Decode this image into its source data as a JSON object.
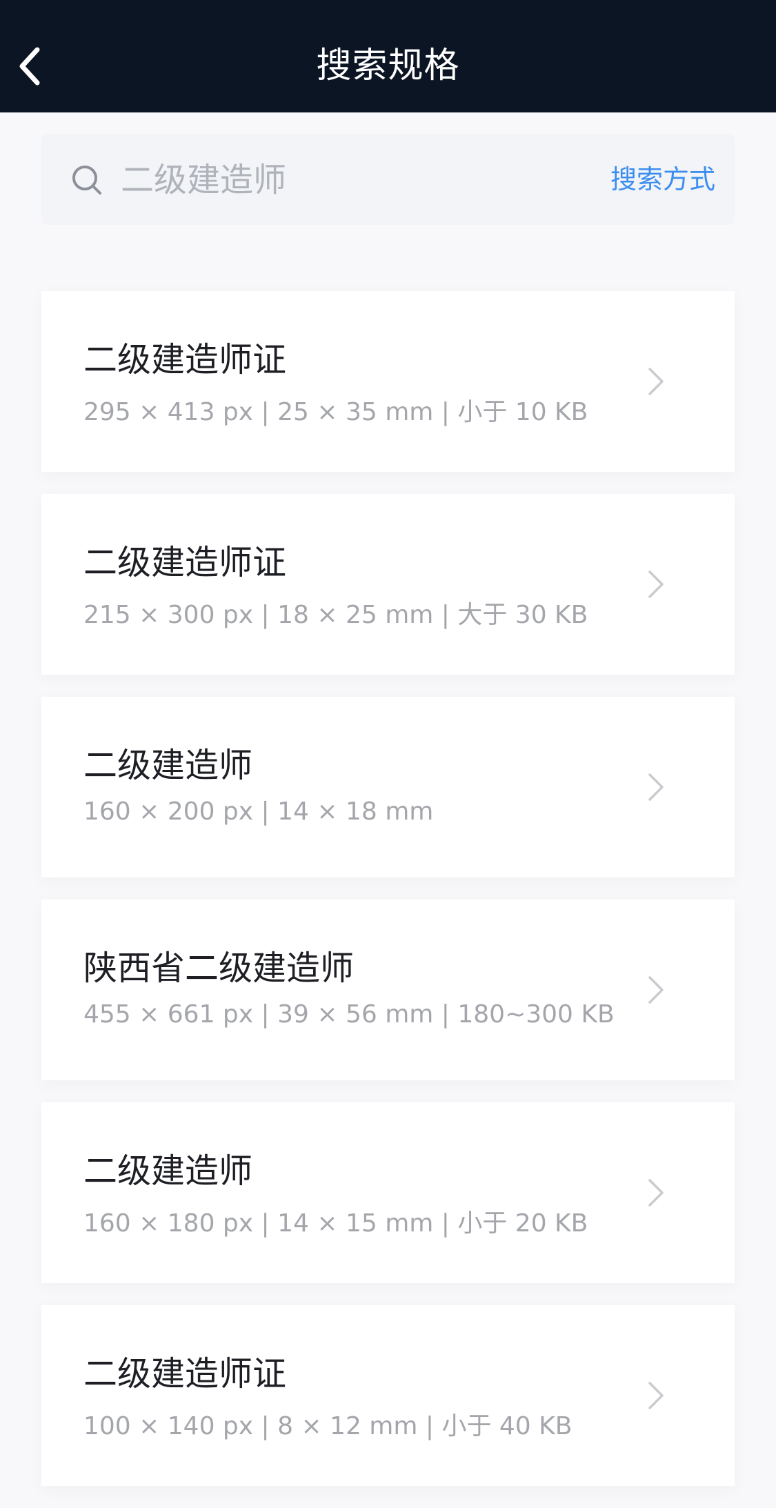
{
  "header": {
    "title": "搜索规格"
  },
  "search": {
    "value": "二级建造师",
    "placeholder": "二级建造师",
    "mode_label": "搜索方式"
  },
  "results": [
    {
      "title": "二级建造师证",
      "spec": "295 × 413 px | 25 × 35 mm | 小于 10 KB"
    },
    {
      "title": "二级建造师证",
      "spec": "215 × 300 px | 18 × 25 mm | 大于 30 KB"
    },
    {
      "title": "二级建造师",
      "spec": "160 × 200 px | 14 × 18 mm"
    },
    {
      "title": "陕西省二级建造师",
      "spec": "455 × 661 px | 39 × 56 mm | 180~300 KB"
    },
    {
      "title": "二级建造师",
      "spec": "160 × 180 px | 14 × 15 mm | 小于 20 KB"
    },
    {
      "title": "二级建造师证",
      "spec": "100 × 140 px | 8 × 12 mm | 小于 40 KB"
    }
  ],
  "colors": {
    "header_bg": "#0b1524",
    "accent": "#3b8ef0",
    "search_bg": "#f2f4f8"
  },
  "icons": {
    "back": "chevron-left-icon",
    "search": "search-icon",
    "row": "chevron-right-icon"
  }
}
